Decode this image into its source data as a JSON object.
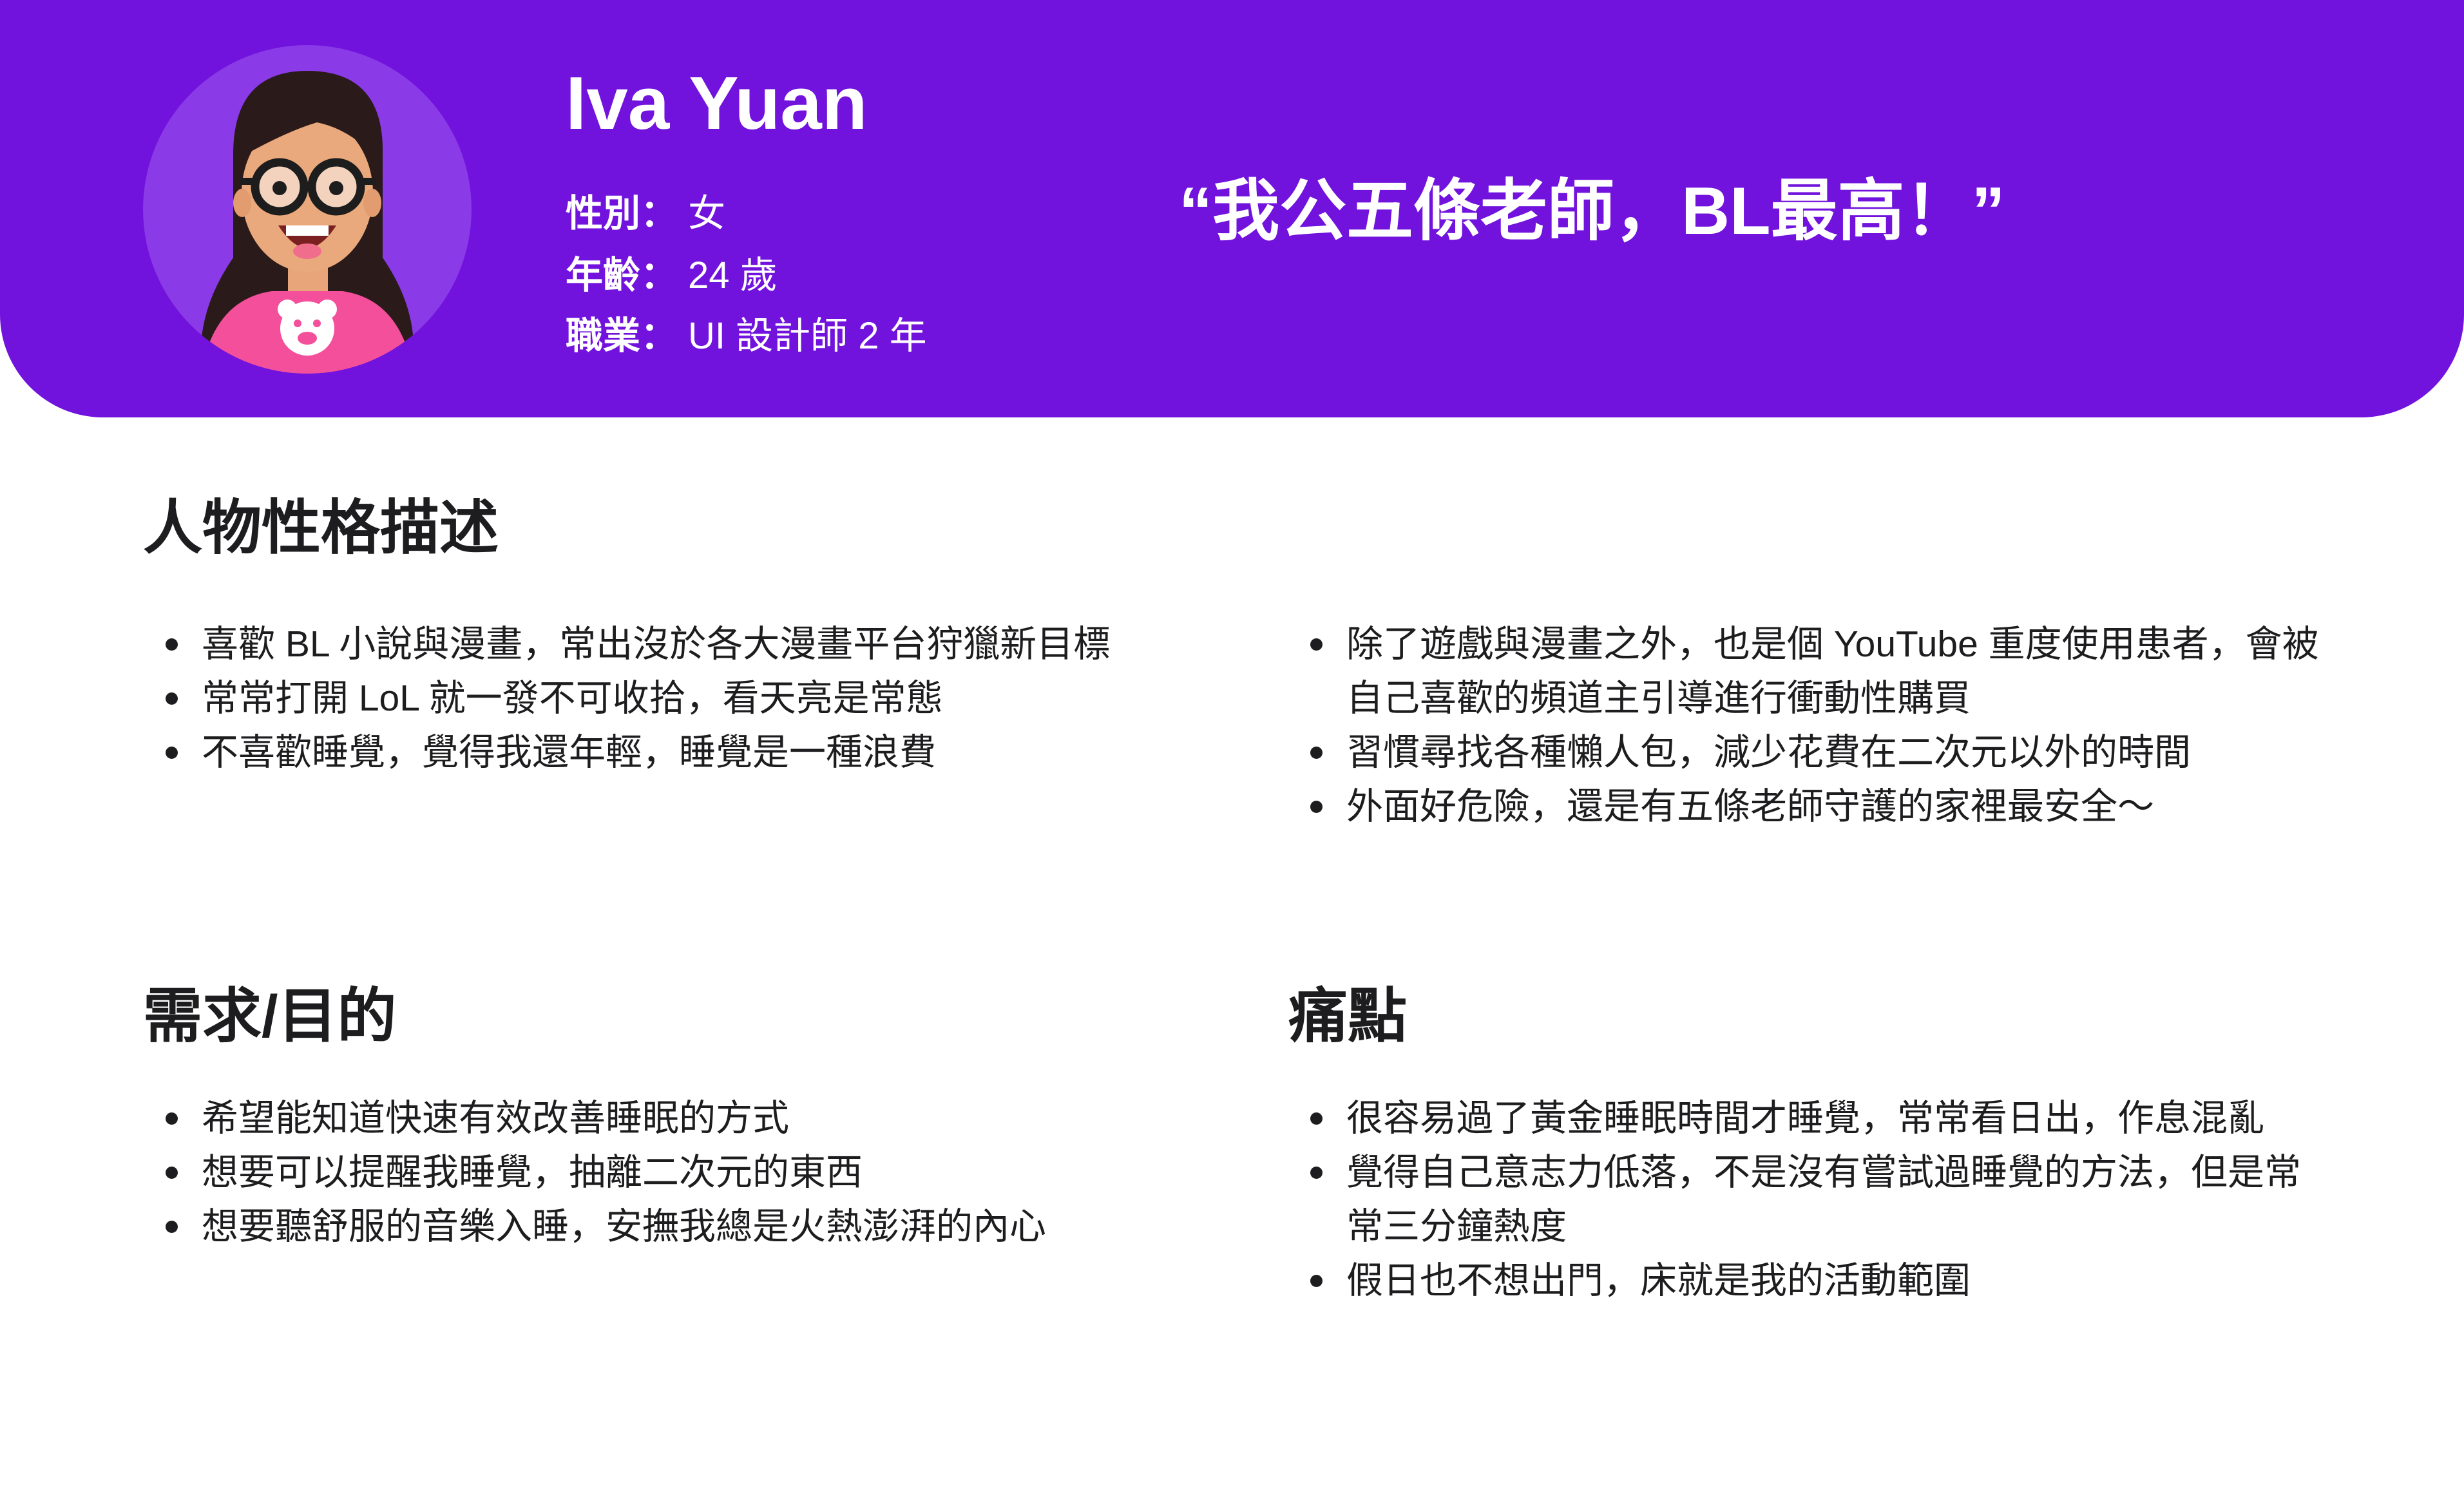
{
  "persona": {
    "name": "Iva Yuan",
    "gender_label": "性別：",
    "gender": "女",
    "age_label": "年齡：",
    "age": "24 歲",
    "job_label": "職業：",
    "job": "UI 設計師 2 年",
    "quote": "“我公五條老師，BL最高！”"
  },
  "colors": {
    "header_bg": "#7112dd",
    "avatar_bg": "#8a3ae6",
    "shirt": "#f34f9a",
    "text": "#1d1d1f"
  },
  "sections": {
    "personality": {
      "title": "人物性格描述",
      "left_items": [
        "喜歡 BL 小說與漫畫，常出沒於各大漫畫平台狩獵新目標",
        "常常打開 LoL 就一發不可收拾，看天亮是常態",
        "不喜歡睡覺，覺得我還年輕，睡覺是一種浪費"
      ],
      "right_items": [
        "除了遊戲與漫畫之外，也是個 YouTube 重度使用患者，會被",
        "自己喜歡的頻道主引導進行衝動性購買",
        "習慣尋找各種懶人包，減少花費在二次元以外的時間",
        "外面好危險，還是有五條老師守護的家裡最安全～"
      ]
    },
    "needs": {
      "title": "需求/目的",
      "items": [
        "希望能知道快速有效改善睡眠的方式",
        "想要可以提醒我睡覺，抽離二次元的東西",
        "想要聽舒服的音樂入睡，安撫我總是火熱澎湃的內心"
      ]
    },
    "pain": {
      "title": "痛點",
      "items": [
        "很容易過了黃金睡眠時間才睡覺，常常看日出，作息混亂",
        "覺得自己意志力低落，不是沒有嘗試過睡覺的方法，但是常",
        "常三分鐘熱度",
        "假日也不想出門，床就是我的活動範圍"
      ]
    }
  },
  "icons": {
    "avatar": "girl-avatar-icon",
    "bullet": "bullet-dot-icon",
    "shirt_logo": "bear-icon"
  }
}
